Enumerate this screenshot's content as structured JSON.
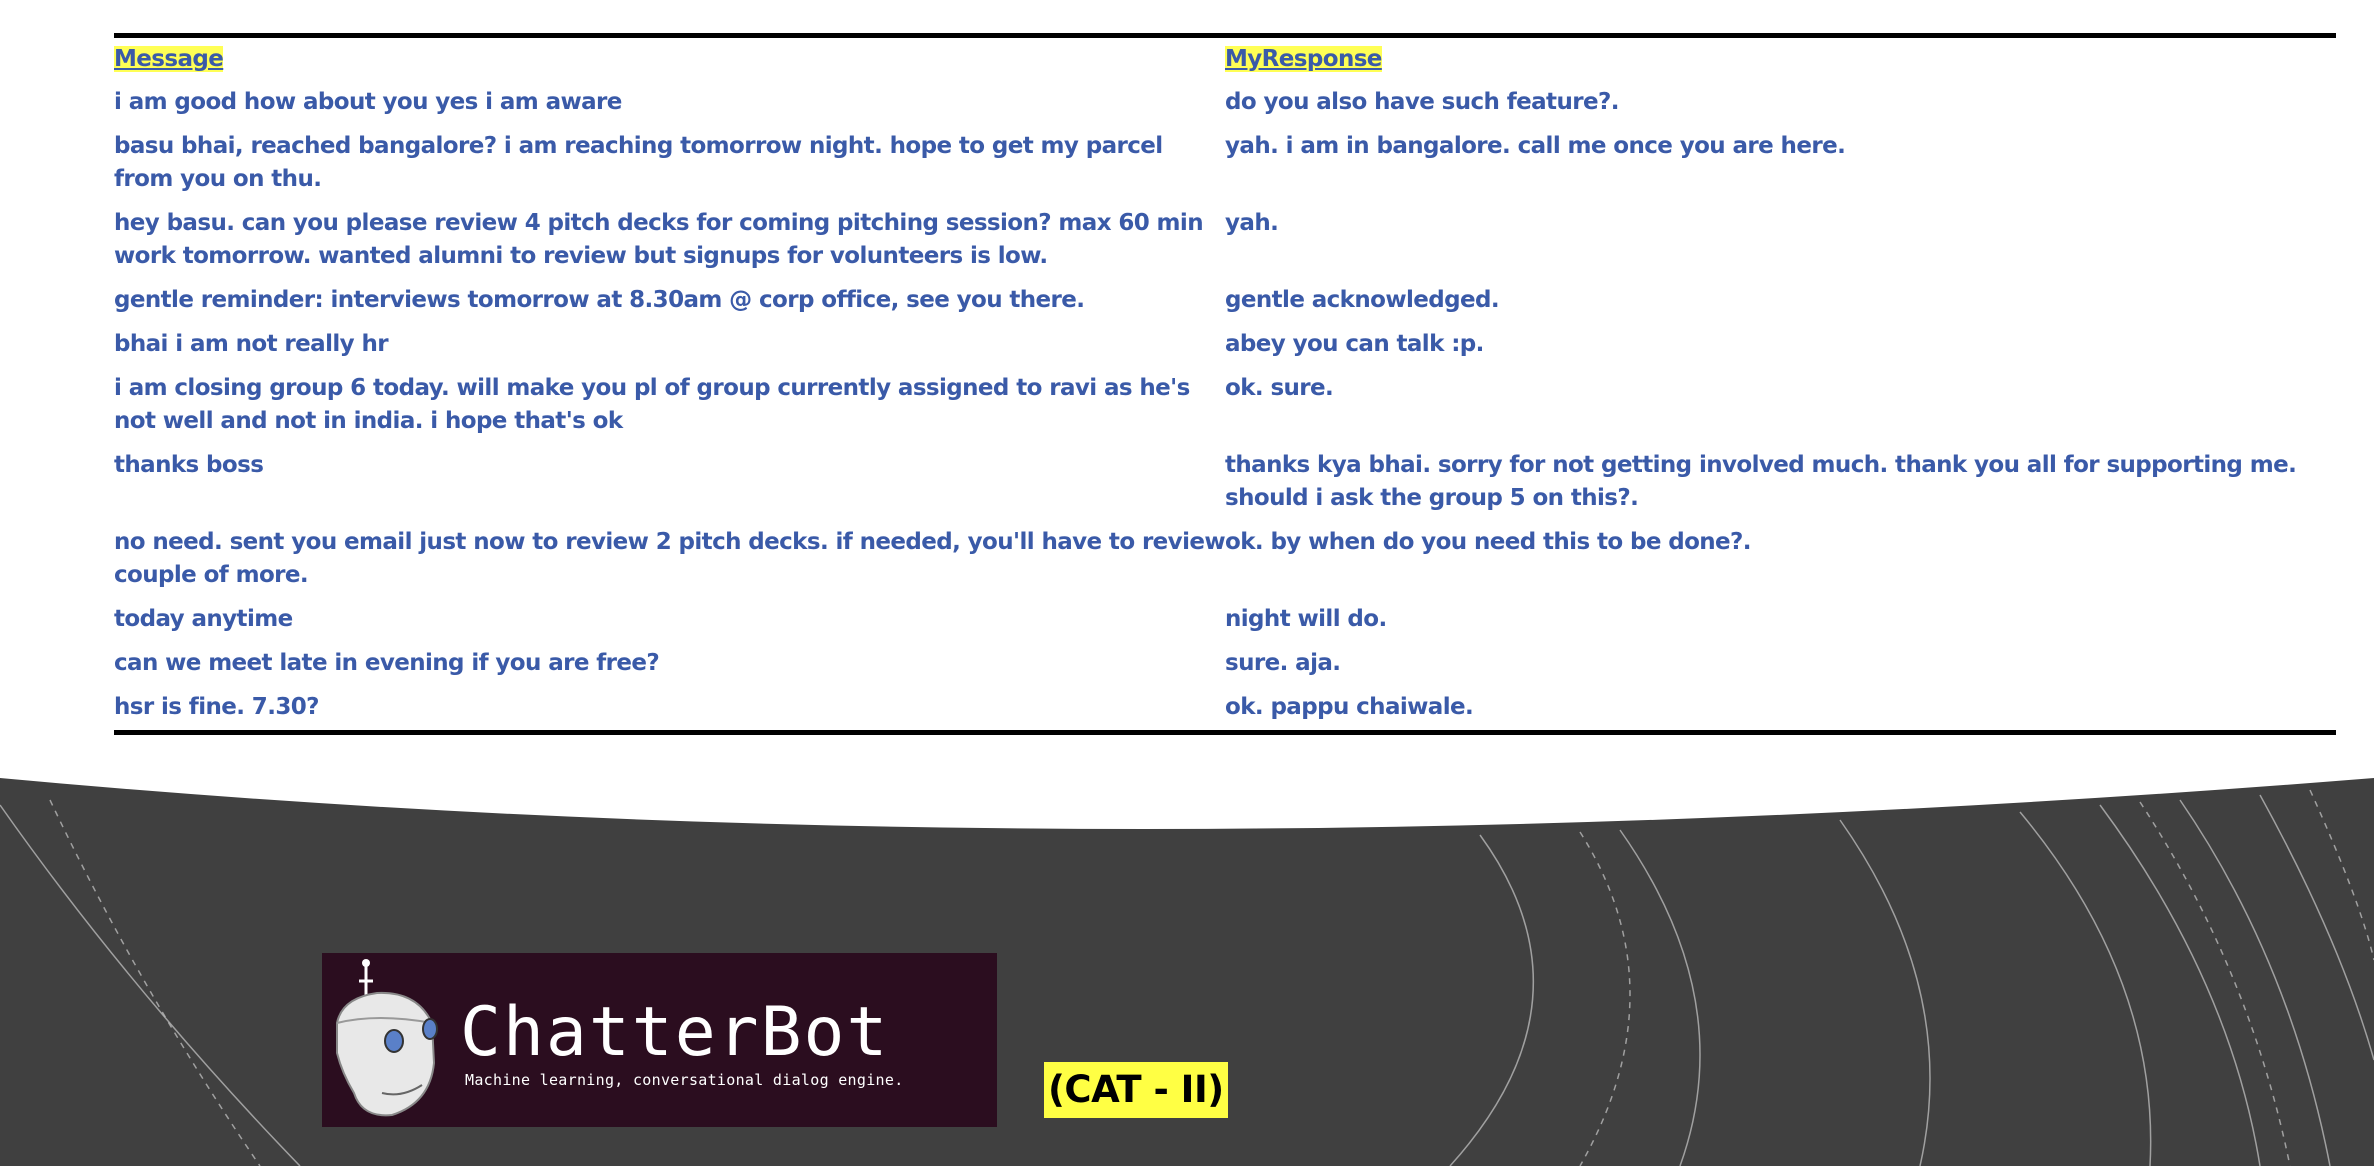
{
  "table": {
    "headers": {
      "message": "Message",
      "response": "MyResponse"
    },
    "rows": [
      {
        "message": "i am good how about you yes i am aware",
        "response": "do you also have such feature?."
      },
      {
        "message": "basu bhai, reached bangalore? i am reaching tomorrow night. hope to get my parcel from you on thu.",
        "response": "yah. i am in bangalore. call me once you are here."
      },
      {
        "message": "hey basu. can you please review 4 pitch decks for coming pitching session? max 60 min work tomorrow. wanted alumni to review but signups for volunteers is low.",
        "response": "yah."
      },
      {
        "message": "gentle reminder:  interviews tomorrow at 8.30am @ corp office, see you there.",
        "response": "gentle acknowledged."
      },
      {
        "message": "bhai i am not really hr",
        "response": "abey you can talk :p."
      },
      {
        "message": "i am closing group 6 today. will make you pl of group currently assigned to ravi as he's not well and not in india. i hope that's ok",
        "response": "ok. sure."
      },
      {
        "message": "thanks boss",
        "response": "thanks kya bhai. sorry for not getting involved much. thank you all for supporting me. should i ask the group 5 on this?."
      },
      {
        "message": "no need. sent you email just now to review 2 pitch decks. if needed, you'll have to review couple of more.",
        "response": "ok. by when do you need this to be done?."
      },
      {
        "message": "today anytime",
        "response": "night will do."
      },
      {
        "message": "can we meet late in evening if you are free?",
        "response": "sure. aja."
      },
      {
        "message": "hsr is fine. 7.30?",
        "response": "ok. pappu chaiwale."
      }
    ]
  },
  "logo": {
    "title": "ChatterBot",
    "tagline": "Machine learning, conversational dialog engine."
  },
  "badge": {
    "label": "(CAT - II)"
  },
  "colors": {
    "text": "#3a5aa8",
    "highlight": "#ffff55",
    "footer": "#404040",
    "logo_bg": "#2b0d1f"
  }
}
